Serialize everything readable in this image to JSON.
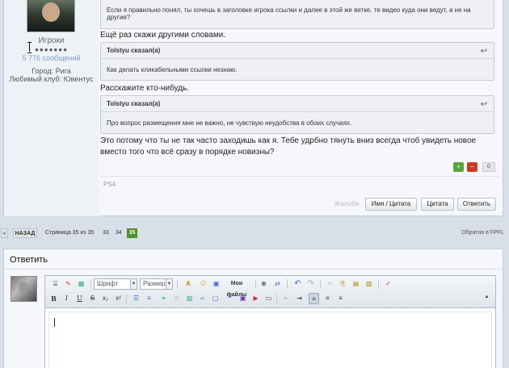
{
  "author": {
    "group": "Игроки",
    "stars": "●●●●●●●",
    "message_count": "5 776 сообщений",
    "city": "Город: Рига",
    "club": "Любимый клуб: Ювентус"
  },
  "post": {
    "quote1_text": "Если я правильно понял, ты хочешь в заголовке игрока ссылки и далее в этой же ветке, те видео куда они ведут, а не на другие?",
    "text1": "Ещё раз скажи другими словами.",
    "quote2_author": "Tolstyu сказал(а)",
    "quote2_text": "Как делать кликабельными ссылки незнаю.",
    "text2": "Расскажите кто-нибудь.",
    "quote3_author": "Tolstyu сказал(а)",
    "quote3_text": "Про вопрос размещения мне не важно, не чувствую неудобства в обоих случаях.",
    "text3": "Это потому что ты не так часто заходишь как я. Тебе удрбно тянуть вниз всегда чтоб увидеть новое вместо того что всё сразу в порядке новизны?",
    "quote_arrow": "↩",
    "rep_up": "+",
    "rep_down": "−",
    "rep_count": "0",
    "signature": "PS4",
    "abuse_label": "Жалоба",
    "name_quote_btn": "Имя / Цитата",
    "quote_btn": "Цитата",
    "reply_btn": "Ответить"
  },
  "pager": {
    "prev": "«",
    "back": "НАЗАД",
    "info": "Страница 35 из 35",
    "p33": "33",
    "p34": "34",
    "p35": "35",
    "back_to": "Обратно в FPFL"
  },
  "reply": {
    "title": "Ответить",
    "font_select": "Шрифт",
    "size_select": "Размер",
    "my_files": "Мои файлы"
  },
  "toolbar_icons": {
    "source": "⌸",
    "eraser": "✎",
    "image": "▦",
    "font_color": "A",
    "smiley": "☺",
    "files": "▣",
    "binoculars": "⊕",
    "replace": "⇄",
    "undo": "↶",
    "redo": "↷",
    "cut": "✂",
    "copy": "⎘",
    "paste": "📋",
    "paste_text": "▤",
    "paste_word": "▥",
    "spell": "✓",
    "bold": "B",
    "italic": "I",
    "underline": "U",
    "strike": "S",
    "sub": "x₂",
    "sup": "x²",
    "bullet": "☰",
    "number": "≡",
    "link": "⚭",
    "unlink": "⊘",
    "img": "▨",
    "code": "‹›",
    "spoiler": "▢",
    "quote": "❝",
    "video": "▣",
    "youtube": "▶",
    "media": "▭",
    "left": "≡",
    "center": "≡",
    "right": "≡",
    "justify": "≡",
    "indent": "⇥",
    "outdent": "⇤",
    "collapse": "▴"
  }
}
